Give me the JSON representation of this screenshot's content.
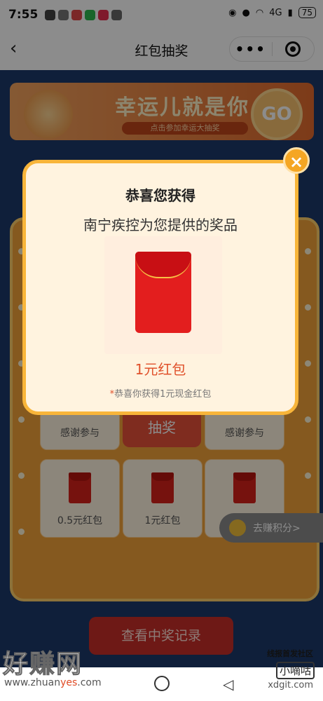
{
  "status": {
    "time": "7:55",
    "battery": "75",
    "network": "4G"
  },
  "appbar": {
    "back_icon": "‹",
    "title": "红包抽奖",
    "more_icon": "•••"
  },
  "banner": {
    "title": "幸运儿就是你",
    "subtitle": "点击参加幸运大抽奖",
    "go": "GO"
  },
  "grid": {
    "top_left": "感谢参与",
    "top_center": "抽奖",
    "top_right": "感谢参与",
    "bottom": [
      "0.5元红包",
      "1元红包",
      ""
    ]
  },
  "record_button": "查看中奖记录",
  "side_button": "去赚积分>",
  "popup": {
    "heading": "恭喜您获得",
    "provider": "南宁疾控为您提供的奖品",
    "prize": "1元红包",
    "note_star": "*",
    "note": "恭喜你获得1元现金红包",
    "close": "×"
  },
  "watermark": {
    "line1": "好赚网",
    "domain_a": "www.zhuan",
    "domain_b": "yes",
    "domain_c": ".com",
    "right_top": "线报首发社区",
    "right_mid": "小嘀咕",
    "right_bottom": "xdgit.com"
  },
  "colors": {
    "accent": "#f5a623",
    "red": "#e31e1e",
    "page_bg": "#1d3a6b"
  }
}
